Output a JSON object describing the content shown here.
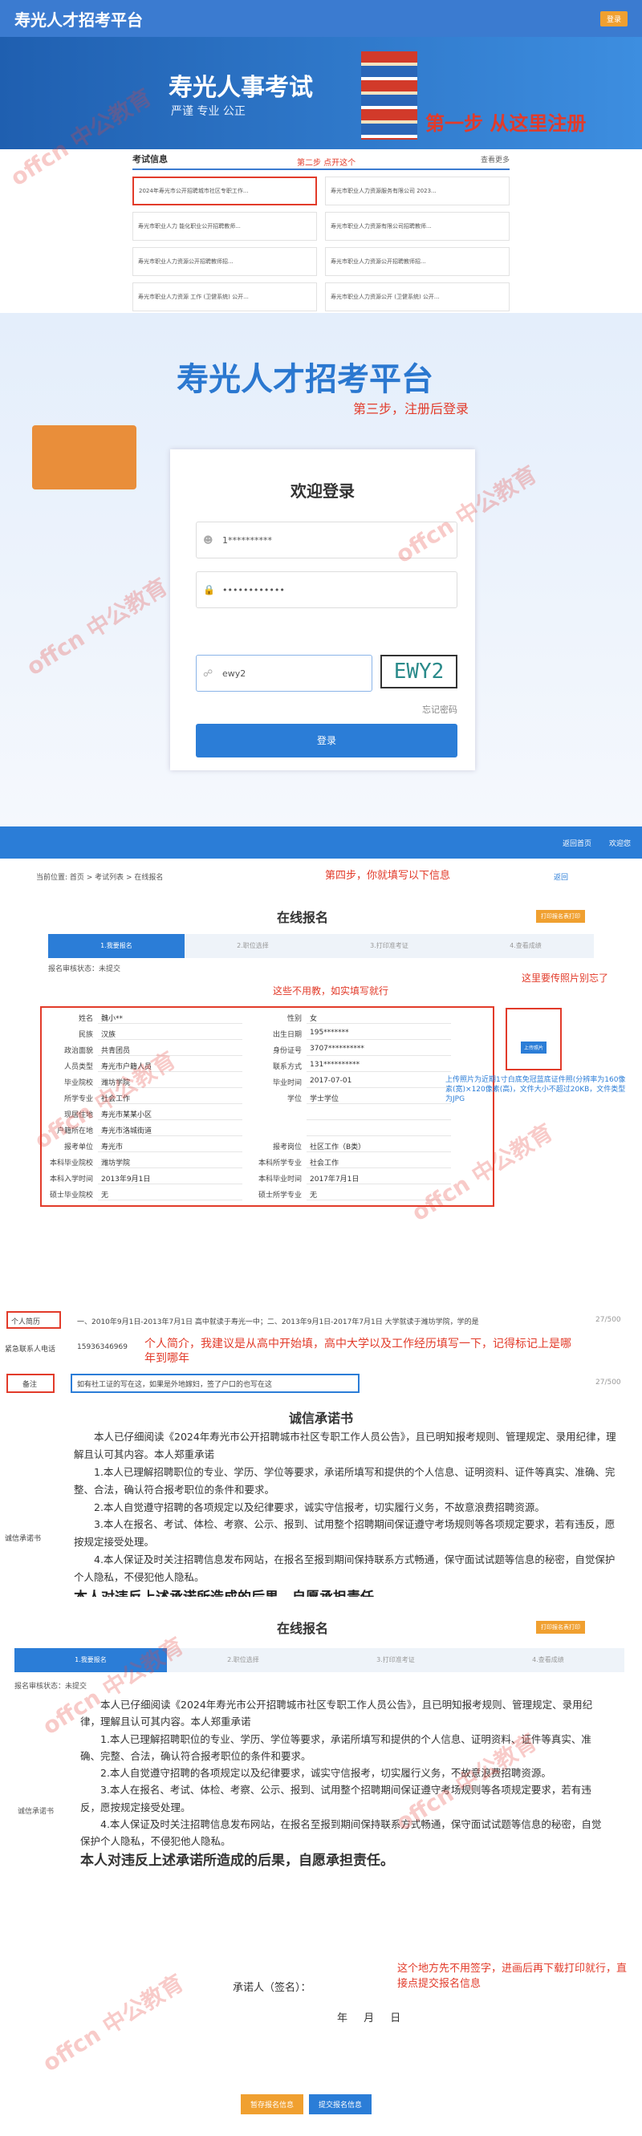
{
  "s1": {
    "logo": "寿光人才招考平台",
    "login_btn": "登录",
    "banner_title": "寿光人事考试",
    "banner_sub": "严谨 专业 公正",
    "step1": "第一步 从这里注册",
    "info_head": "考试信息",
    "info_more": "查看更多",
    "step2": "第二步 点开这个",
    "items": [
      "2024年寿光市公开招聘城市社区专职工作...",
      "寿光市职业人力资源服务有限公司 2023...",
      "寿光市职业人力 能化职业公开招聘教师...",
      "寿光市职业人力资源有限公司招聘教师...",
      "寿光市职业人力资源公开招聘教师招...",
      "寿光市职业人力资源公开招聘教师招...",
      "寿光市职业人力资源 工作 (卫健系统) 公开...",
      "寿光市职业人力资源公开 (卫健系统) 公开..."
    ]
  },
  "s2": {
    "title": "寿光人才招考平台",
    "step3": "第三步，注册后登录",
    "welcome": "欢迎登录",
    "user": "1**********",
    "pwd": "••••••••••••",
    "captcha_input": "ewy2",
    "captcha": "EWY2",
    "forgot": "忘记密码",
    "login": "登录"
  },
  "s3": {
    "nav": [
      "返回首页",
      "欢迎您"
    ],
    "crumb": "当前位置: 首页 > 考试列表 > 在线报名",
    "back": "返回",
    "step4": "第四步，你就填写以下信息",
    "title": "在线报名",
    "download": "打印报名表打印",
    "steps": [
      "1.我要报名",
      "2.职位选择",
      "3.打印准考证",
      "4.查看成绩"
    ],
    "status": "报名审核状态：未提交",
    "note1": "这些不用教，如实填写就行",
    "note2": "这里要传照片别忘了",
    "upload": "上传照片",
    "note3": "上传照片为近期1寸白底免冠蓝底证件照(分辨率为160像素(宽)×120像素(高)，文件大小不超过20KB，文件类型为JPG",
    "rows": [
      [
        "姓名",
        "魏小**",
        "性别",
        "女"
      ],
      [
        "民族",
        "汉族",
        "出生日期",
        "195*******"
      ],
      [
        "政治面貌",
        "共青团员",
        "身份证号",
        "3707**********"
      ],
      [
        "人员类型",
        "寿光市户籍人员",
        "联系方式",
        "131**********"
      ],
      [
        "毕业院校",
        "潍坊学院",
        "毕业时间",
        "2017-07-01"
      ],
      [
        "所学专业",
        "社会工作",
        "学位",
        "学士学位"
      ],
      [
        "现居住地",
        "寿光市某某小区",
        "",
        ""
      ],
      [
        "户籍所在地",
        "寿光市洛城街道",
        "",
        ""
      ],
      [
        "报考单位",
        "寿光市",
        "报考岗位",
        "社区工作（B类）"
      ],
      [
        "本科毕业院校",
        "潍坊学院",
        "本科所学专业",
        "社会工作"
      ],
      [
        "本科入学时间",
        "2013年9月1日",
        "本科毕业时间",
        "2017年7月1日"
      ],
      [
        "硕士毕业院校",
        "无",
        "硕士所学专业",
        "无"
      ]
    ]
  },
  "s4": {
    "resume_label": "个人简历",
    "resume_text": "一、2010年9月1日-2013年7月1日 高中就读于寿光一中；二、2013年9月1日-2017年7月1日 大学就读于潍坊学院，学的是",
    "counter1": "27/500",
    "emergency_label": "紧急联系人电话",
    "emergency": "15936346969",
    "note_label": "备注",
    "note_text": "如有社工证的写在这，如果是外地嫁妇，签了户口的也写在这",
    "counter2": "27/500",
    "note5": "个人简介，我建议是从高中开始填，高中大学以及工作经历填写一下，记得标记上是哪年到哪年",
    "ctitle": "诚信承诺书",
    "commit_label": "诚信承诺书",
    "p1": "本人已仔细阅读《2024年寿光市公开招聘城市社区专职工作人员公告》，且已明知报考规则、管理规定、录用纪律，理解且认可其内容。本人郑重承诺",
    "p2": "1.本人已理解招聘职位的专业、学历、学位等要求，承诺所填写和提供的个人信息、证明资料、证件等真实、准确、完整、合法，确认符合报考职位的条件和要求。",
    "p3": "2.本人自觉遵守招聘的各项规定以及纪律要求，诚实守信报考，切实履行义务，不故意浪费招聘资源。",
    "p4": "3.本人在报名、考试、体检、考察、公示、报到、试用整个招聘期间保证遵守考场规则等各项规定要求，若有违反，愿按规定接受处理。",
    "p5": "4.本人保证及时关注招聘信息发布网站，在报名至报到期间保持联系方式畅通，保守面试试题等信息的秘密，自觉保护个人隐私，不侵犯他人隐私。",
    "p6": "本人对违反上述承诺所造成的后果，自愿承担责任。"
  },
  "s5": {
    "title": "在线报名",
    "download": "打印报名表打印",
    "steps": [
      "1.我要报名",
      "2.职位选择",
      "3.打印准考证",
      "4.查看成绩"
    ],
    "status": "报名审核状态：未提交",
    "side": "诚信承诺书",
    "note6": "这个地方先不用签字，进画后再下载打印就行，直接点提交报名信息",
    "sign": "承诺人（签名）：",
    "date": "年 月 日",
    "b1": "暂存报名信息",
    "b2": "提交报名信息"
  },
  "watermark": "offcn 中公教育"
}
